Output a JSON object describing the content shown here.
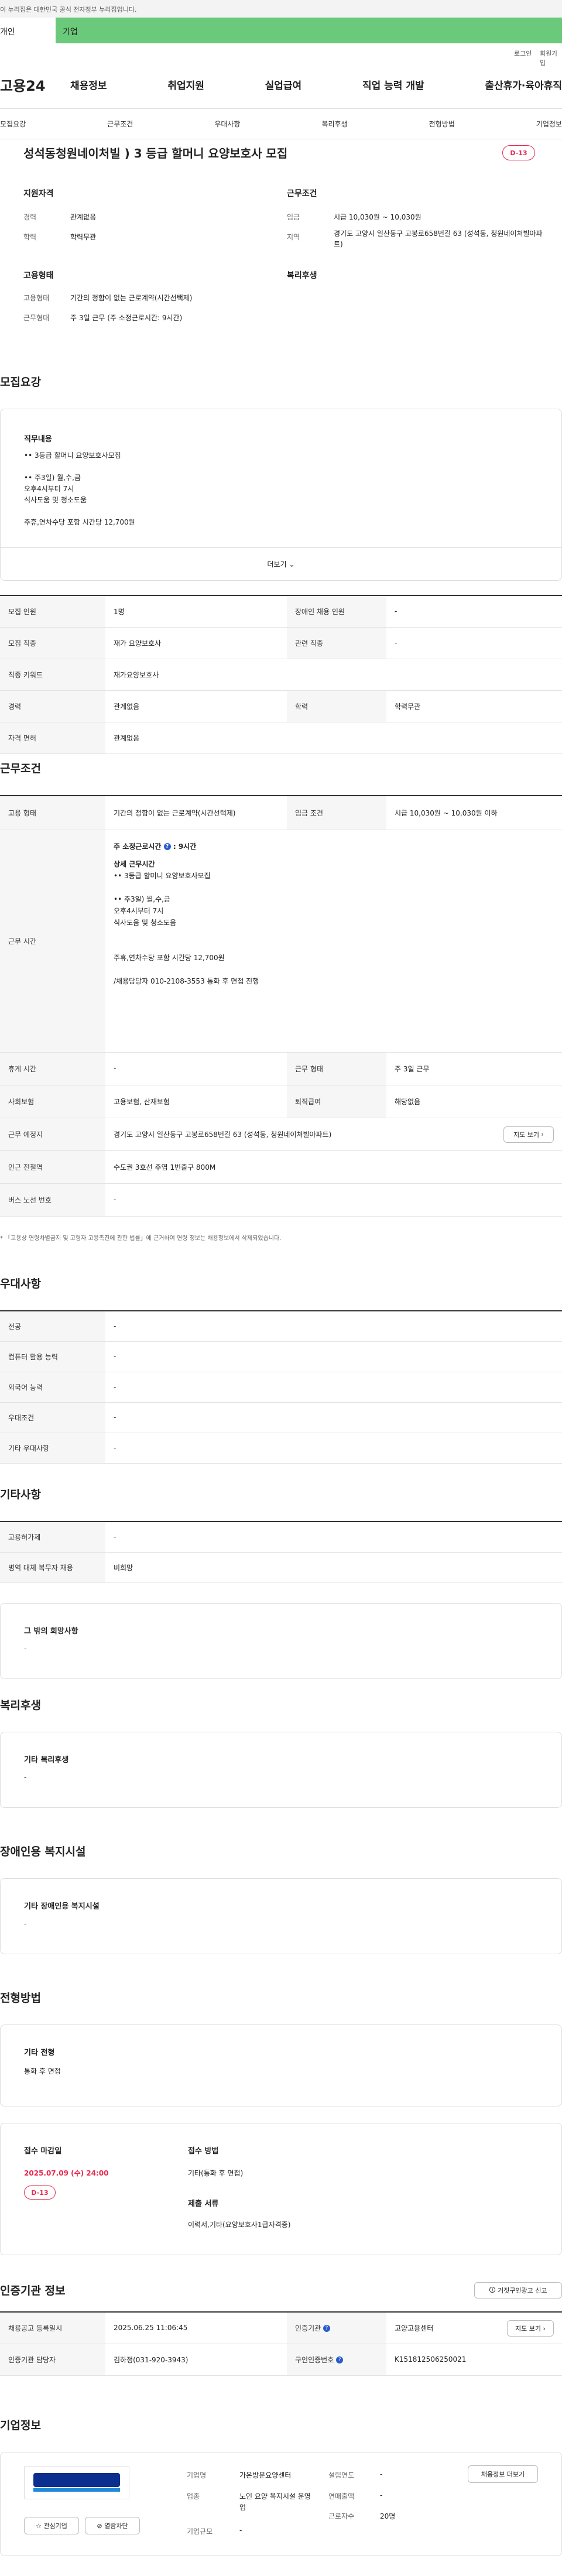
{
  "top": {
    "gov_notice": "이 누리집은 대한민국 공식 전자정부 누리집입니다.",
    "tab_personal": "개인",
    "tab_corp": "기업",
    "login": "로그인",
    "join": "회원가입"
  },
  "gnb": {
    "logo": "고용24",
    "menu": [
      "채용정보",
      "취업지원",
      "실업급여",
      "직업 능력 개발",
      "출산휴가·육아휴직"
    ]
  },
  "subnav": [
    "모집요강",
    "근무조건",
    "우대사항",
    "복리후생",
    "전형방법",
    "기업정보"
  ],
  "header": {
    "title": "성석동청원네이처빌 ) 3 등급 할머니 요양보호사 모집",
    "dday": "D-13",
    "qual_title": "지원자격",
    "career_label": "경력",
    "career": "관계없음",
    "edu_label": "학력",
    "edu": "학력무관",
    "cond_title": "근무조건",
    "wage_label": "임금",
    "wage": "시급 10,030원 ~ 10,030원",
    "loc_label": "지역",
    "loc": "경기도 고양시 일산동구 고봉로658번길 63 (성석동, 청원네이처빌아파트)",
    "emp_title": "고용형태",
    "emptype_label": "고용형태",
    "emptype": "기간의 정함이 없는 근로계약(시간선택제)",
    "worktype_label": "근무형태",
    "worktype": "주 3일 근무 (주 소정근로시간: 9시간)",
    "welfare_title": "복리후생"
  },
  "recruit": {
    "title": "모집요강",
    "duty_label": "직무내용",
    "duty_lines": [
      "•• 3등급 할머니 요양보호사모집",
      "",
      "•• 주3일) 월,수,금",
      "오후4시부터 7시",
      "식사도움 및 청소도움",
      "",
      "주휴,연차수당 포함 시간당 12,700원"
    ],
    "more": "더보기",
    "rows": [
      [
        "모집 인원",
        "1명",
        "장애인 채용 인원",
        "-"
      ],
      [
        "모집 직종",
        "재가 요양보호사",
        "관련 직종",
        "-"
      ],
      [
        "직종 키워드",
        "재가요양보호사",
        "",
        ""
      ],
      [
        "경력",
        "관계없음",
        "학력",
        "학력무관"
      ],
      [
        "자격 면허",
        "관계없음",
        "",
        ""
      ]
    ]
  },
  "cond": {
    "title": "근무조건",
    "emptype_label": "고용 형태",
    "emptype": "기간의 정함이 없는 근로계약(시간선택제)",
    "wage_label": "임금 조건",
    "wage": "시급 10,030원 ~ 10,030원 이하",
    "hours_label": "근무 시간",
    "hours_head": "주 소정근로시간",
    "hours_val": ": 9시간",
    "hours_lines": [
      "상세 근무시간",
      "•• 3등급 할머니 요양보호사모집",
      "",
      "•• 주3일) 월,수,금",
      "오후4시부터 7시",
      "식사도움 및 청소도움",
      "",
      "",
      "주휴,연차수당 포함 시간당 12,700원",
      "",
      "/채용담당자 010-2108-3553 통화 후 면접 진행"
    ],
    "rest_label": "휴게 시간",
    "rest": "-",
    "form_label": "근무 형태",
    "form": "주 3일 근무",
    "ins_label": "사회보험",
    "ins": "고용보험, 산재보험",
    "sev_label": "퇴직급여",
    "sev": "해당없음",
    "place_label": "근무 예정지",
    "place": "경기도 고양시 일산동구 고봉로658번길 63 (성석동, 청원네이처빌아파트)",
    "map_btn": "지도 보기",
    "subway_label": "인근 전철역",
    "subway": "수도권 3호선 주엽 1번출구 800M",
    "bus_label": "버스 노선 번호",
    "bus": "-",
    "note": "* 「고용상 연령차별금지 및 고령자 고용촉진에 관한 법률」에 근거하여 연령 정보는 채용정보에서 삭제되었습니다."
  },
  "pref": {
    "title": "우대사항",
    "rows": [
      [
        "전공",
        "-"
      ],
      [
        "컴퓨터 활용 능력",
        "-"
      ],
      [
        "외국어 능력",
        "-"
      ],
      [
        "우대조건",
        "-"
      ],
      [
        "기타 우대사항",
        "-"
      ]
    ]
  },
  "etc": {
    "title": "기타사항",
    "rows": [
      [
        "고용허가제",
        "-"
      ],
      [
        "병역 대체 복무자 채용",
        "비희망"
      ]
    ],
    "hope_title": "그 밖의 희망사항",
    "hope": "-"
  },
  "welfare": {
    "title": "복리후생",
    "box_title": "기타 복리후생",
    "box_val": "-"
  },
  "disab": {
    "title": "장애인용 복지시설",
    "box_title": "기타 장애인용 복지시설",
    "box_val": "-"
  },
  "selection": {
    "title": "전형방법",
    "other_title": "기타 전형",
    "other_val": "통화 후 면접",
    "deadline_label": "접수 마감일",
    "deadline": "2025.07.09 (수) 24:00",
    "dday": "D-13",
    "method_label": "접수 방법",
    "method": "기타(통화 후 면접)",
    "docs_label": "제출 서류",
    "docs": "이력서,기타(요양보호사1급자격증)"
  },
  "agency": {
    "title": "인증기관 정보",
    "report_btn": "거짓구인광고 신고",
    "reg_label": "채용공고 등록일시",
    "reg": "2025.06.25 11:06:45",
    "agency_label": "인증기관",
    "agency": "고양고용센터",
    "map_btn": "지도 보기",
    "staff_label": "인증기관 담당자",
    "staff": "김하정(031-920-3943)",
    "id_label": "구인인증번호",
    "id": "K151812506250021"
  },
  "company": {
    "title": "기업정보",
    "logo_text": "ONON",
    "interest_btn": "관심기업",
    "apply_btn": "열람차단",
    "name_label": "기업명",
    "name": "가온방문요양센터",
    "ind_label": "업종",
    "ind": "노인 요양 복지시설 운영업",
    "scale_label": "기업규모",
    "scale": "-",
    "est_label": "설립연도",
    "est": "-",
    "rev_label": "연매출액",
    "rev": "-",
    "emp_label": "근로자수",
    "emp": "20명",
    "info_btn": "채용정보 더보기"
  }
}
